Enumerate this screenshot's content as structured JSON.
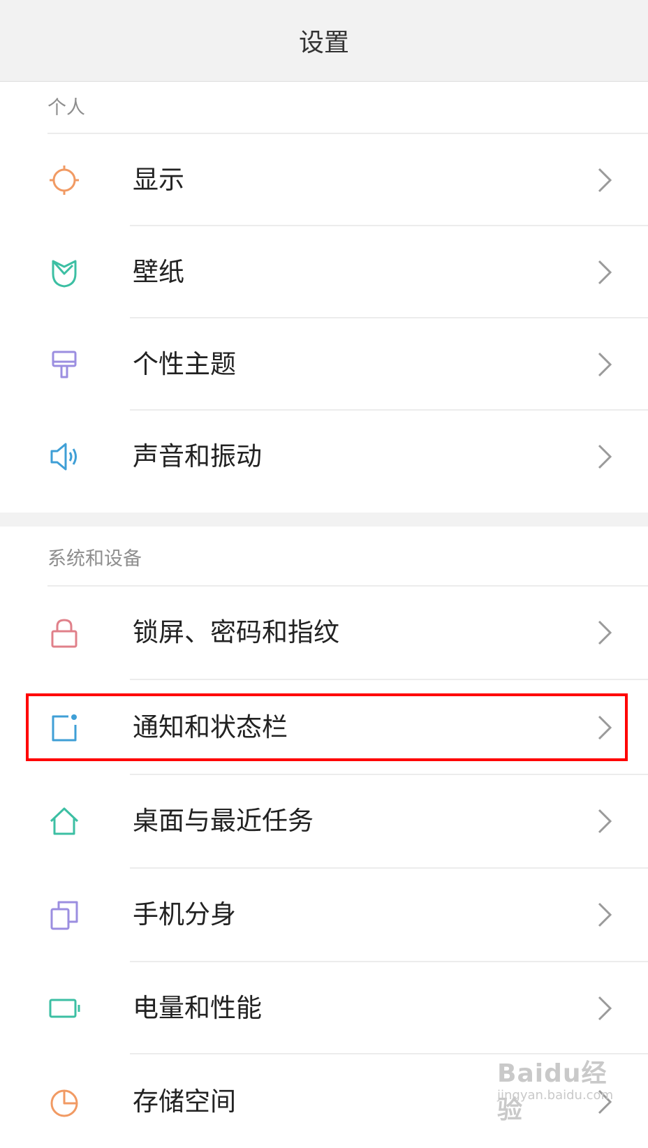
{
  "header": {
    "title": "设置"
  },
  "sections": [
    {
      "title": "个人",
      "items": [
        {
          "label": "显示",
          "icon": "sun-icon",
          "color": "#f19a63"
        },
        {
          "label": "壁纸",
          "icon": "tulip-icon",
          "color": "#3cbfa3"
        },
        {
          "label": "个性主题",
          "icon": "paint-roller-icon",
          "color": "#9b8ee0"
        },
        {
          "label": "声音和振动",
          "icon": "speaker-icon",
          "color": "#3f9fd6"
        }
      ]
    },
    {
      "title": "系统和设备",
      "items": [
        {
          "label": "锁屏、密码和指纹",
          "icon": "lock-icon",
          "color": "#e0808a"
        },
        {
          "label": "通知和状态栏",
          "icon": "notification-icon",
          "color": "#3f9fd6"
        },
        {
          "label": "桌面与最近任务",
          "icon": "home-icon",
          "color": "#3cbfa3"
        },
        {
          "label": "手机分身",
          "icon": "dual-app-icon",
          "color": "#9b8ee0"
        },
        {
          "label": "电量和性能",
          "icon": "battery-icon",
          "color": "#3cbfa3"
        },
        {
          "label": "存储空间",
          "icon": "storage-pie-icon",
          "color": "#f19a63"
        }
      ]
    }
  ],
  "highlight_color": "#ff0000",
  "watermark": {
    "logo": "Baidu经验",
    "url": "jingyan.baidu.com"
  }
}
